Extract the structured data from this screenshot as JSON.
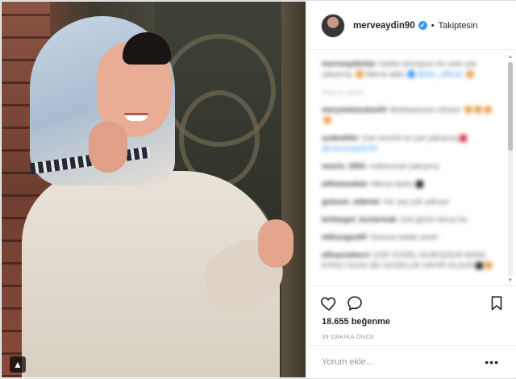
{
  "post": {
    "author": "merveaydin90",
    "follow_status": "Takiptesin",
    "separator": "•",
    "verified_mark": "✔"
  },
  "comments": [
    {
      "user": "merveaydinfan",
      "text": "harika olmuşsun bu renk çok yakışmış",
      "extra": "Merve abla ",
      "mention": "@fan_official"
    },
    {
      "user": "",
      "text": "Takip et, yanıtla"
    },
    {
      "user": "meryemkaratas04",
      "text": "Muhteşemsin efsane"
    },
    {
      "user": "sudeekilic",
      "text": "Çok sevimli ve çok yakışmış ",
      "mention": "@merveaydin90"
    },
    {
      "user": "nesrin_0591",
      "text": "mükemmel yakışmış"
    },
    {
      "user": "elifsimsekler",
      "text": "Merve Aydın"
    },
    {
      "user": "gulsum_aldemir",
      "text": "her şey çok yakıyor"
    },
    {
      "user": "kirliaegol_kurtarmak",
      "text": "Çok güzel olmuş bu"
    },
    {
      "user": "elifnurgoz00",
      "text": "Sonuna kadar senin"
    },
    {
      "user": "elfnazsekerci",
      "text": "ÇOK GÜZEL OLMUŞSUN NASIL ETKİLİ OLDU BU GÜZELLİK HAYIR OLSUN"
    }
  ],
  "actions": {
    "like_icon": "heart-outline-icon",
    "comment_icon": "speech-bubble-icon",
    "save_icon": "bookmark-icon",
    "likes_count": "18.655 beğenme",
    "timestamp": "39 DAKİKA ÖNCE"
  },
  "comment_box": {
    "placeholder": "Yorum ekle...",
    "more_label": "•••"
  },
  "photo": {
    "type_badge": "▲"
  }
}
